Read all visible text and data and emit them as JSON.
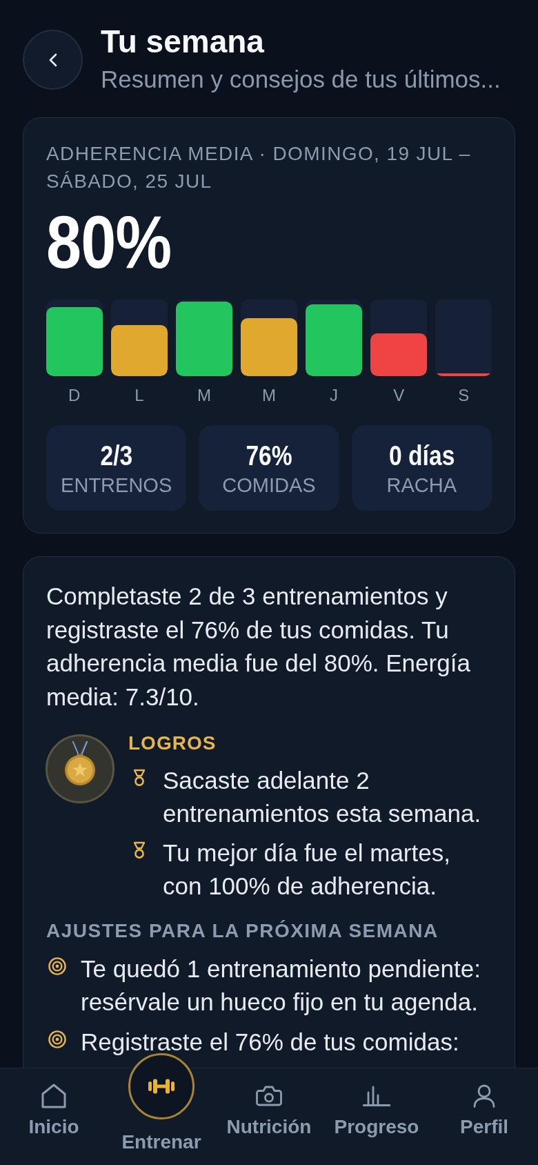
{
  "header": {
    "title": "Tu semana",
    "subtitle": "Resumen y consejos de tus últimos..."
  },
  "summary": {
    "caption": "ADHERENCIA MEDIA · DOMINGO, 19 JUL – SÁBADO, 25 JUL",
    "value": "80%",
    "days": [
      {
        "label": "D",
        "level": 0.9,
        "color": "#22c55e"
      },
      {
        "label": "L",
        "level": 0.67,
        "color": "#e0a82e"
      },
      {
        "label": "M",
        "level": 0.97,
        "color": "#22c55e"
      },
      {
        "label": "M",
        "level": 0.76,
        "color": "#e0a82e"
      },
      {
        "label": "J",
        "level": 0.94,
        "color": "#22c55e"
      },
      {
        "label": "V",
        "level": 0.56,
        "color": "#ef4444"
      },
      {
        "label": "S",
        "level": 0.04,
        "color": "#ef4444"
      }
    ],
    "stats": [
      {
        "value": "2/3",
        "label": "ENTRENOS"
      },
      {
        "value": "76%",
        "label": "COMIDAS"
      },
      {
        "value": "0 días",
        "label": "RACHA"
      }
    ]
  },
  "insights": {
    "text": "Completaste 2 de 3 entrenamientos y registraste el 76% de tus comidas. Tu adherencia media fue del 80%. Energía media: 7.3/10.",
    "achievements": {
      "title": "LOGROS",
      "items": [
        "Sacaste adelante 2 entrenamientos esta semana.",
        "Tu mejor día fue el martes, con 100% de adherencia."
      ]
    },
    "adjustments": {
      "title": "AJUSTES PARA LA PRÓXIMA SEMANA",
      "items": [
        "Te quedó 1 entrenamiento pendiente: resérvale un hueco fijo en tu agenda.",
        "Registraste el 76% de tus comidas:"
      ]
    }
  },
  "nav": [
    {
      "label": "Inicio",
      "kind": "tab",
      "selected": false
    },
    {
      "label": "Entrenar",
      "kind": "center",
      "selected": false
    },
    {
      "label": "Nutrición",
      "kind": "tab",
      "selected": false
    },
    {
      "label": "Progreso",
      "kind": "tab",
      "selected": false
    },
    {
      "label": "Perfil",
      "kind": "tab",
      "selected": false
    }
  ]
}
